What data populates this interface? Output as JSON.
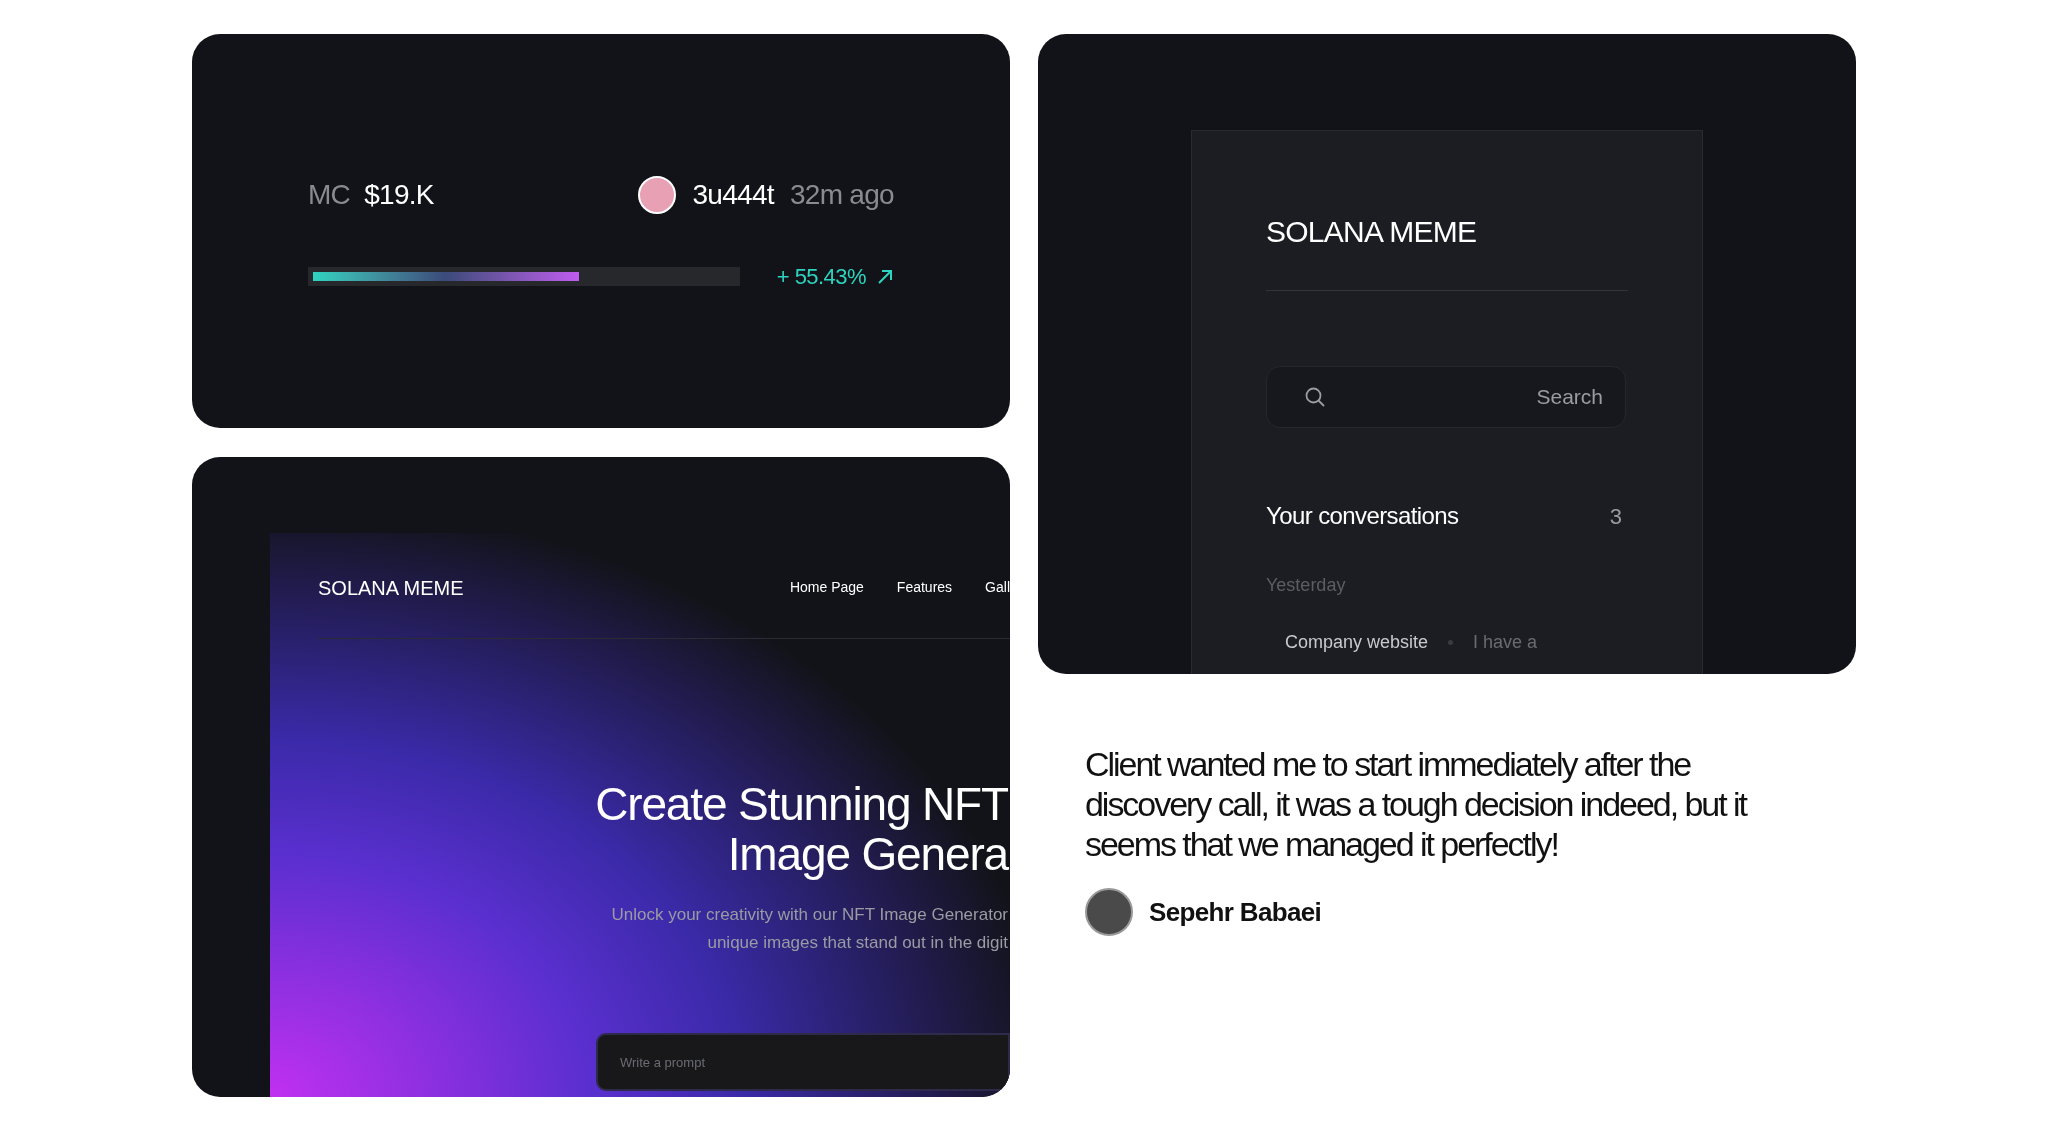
{
  "token_card": {
    "label": "MC",
    "market_cap": "$19.K",
    "user": "3u444t",
    "time": "32m ago",
    "progress": {
      "level": 0.63
    },
    "change": "+ 55.43%"
  },
  "chat_card": {
    "title": "SOLANA MEME",
    "search": {
      "placeholder": "Search"
    },
    "section_title": "Your conversations",
    "count": "3",
    "group": "Yesterday",
    "conversations": [
      {
        "title": "Company website",
        "preview": "I have a"
      }
    ]
  },
  "landing_card": {
    "logo": "SOLANA MEME",
    "nav": [
      "Home Page",
      "Features",
      "Gall"
    ],
    "headline": [
      "Create Stunning NFT",
      "Image Genera"
    ],
    "subtitle": [
      "Unlock your creativity with our NFT Image Generator",
      "unique images that stand out in the digit"
    ],
    "prompt": {
      "placeholder": "Write a prompt"
    }
  },
  "testimonial": {
    "quote": "Client wanted me to start immediately after the discovery call, it was a tough decision indeed, but it seems that we managed it perfectly!",
    "author": "Sepehr Babaei"
  }
}
